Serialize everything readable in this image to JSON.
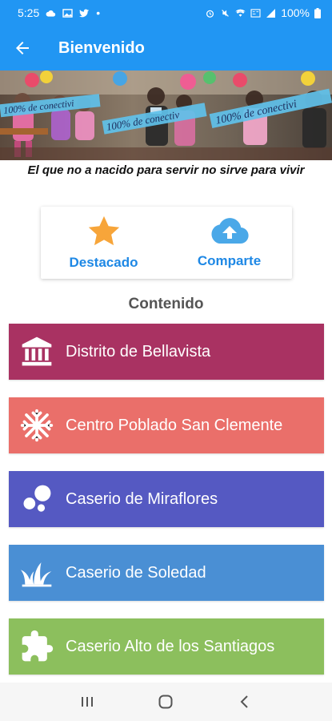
{
  "status_bar": {
    "time": "5:25",
    "dot": "•",
    "battery": "100%"
  },
  "app_bar": {
    "title": "Bienvenido",
    "back_icon": "arrow-left-icon"
  },
  "banner": {
    "caption_1": "100% de conectivi",
    "caption_2": "100% de conectiv",
    "caption_3": "100% de conectivi"
  },
  "motto": "El que no a nacido para servir no sirve para vivir",
  "actions": [
    {
      "label": "Destacado",
      "icon": "star-icon",
      "color": "#f7a53a"
    },
    {
      "label": "Comparte",
      "icon": "cloud-upload-icon",
      "color": "#4aa8e8"
    }
  ],
  "section_title": "Contenido",
  "menu": [
    {
      "label": "Distrito de Bellavista",
      "icon": "bank-icon",
      "color": "#a93262"
    },
    {
      "label": "Centro Poblado San Clemente",
      "icon": "snowflake-icon",
      "color": "#ea6f6a"
    },
    {
      "label": "Caserio de Miraflores",
      "icon": "bubbles-icon",
      "color": "#5559c2"
    },
    {
      "label": "Caserio de Soledad",
      "icon": "grass-icon",
      "color": "#4a8fd4"
    },
    {
      "label": "Caserio Alto de los Santiagos",
      "icon": "puzzle-icon",
      "color": "#8cbf5d"
    }
  ],
  "nav_bar": {
    "recents": "recents-icon",
    "home": "home-icon",
    "back": "back-chevron-icon"
  }
}
